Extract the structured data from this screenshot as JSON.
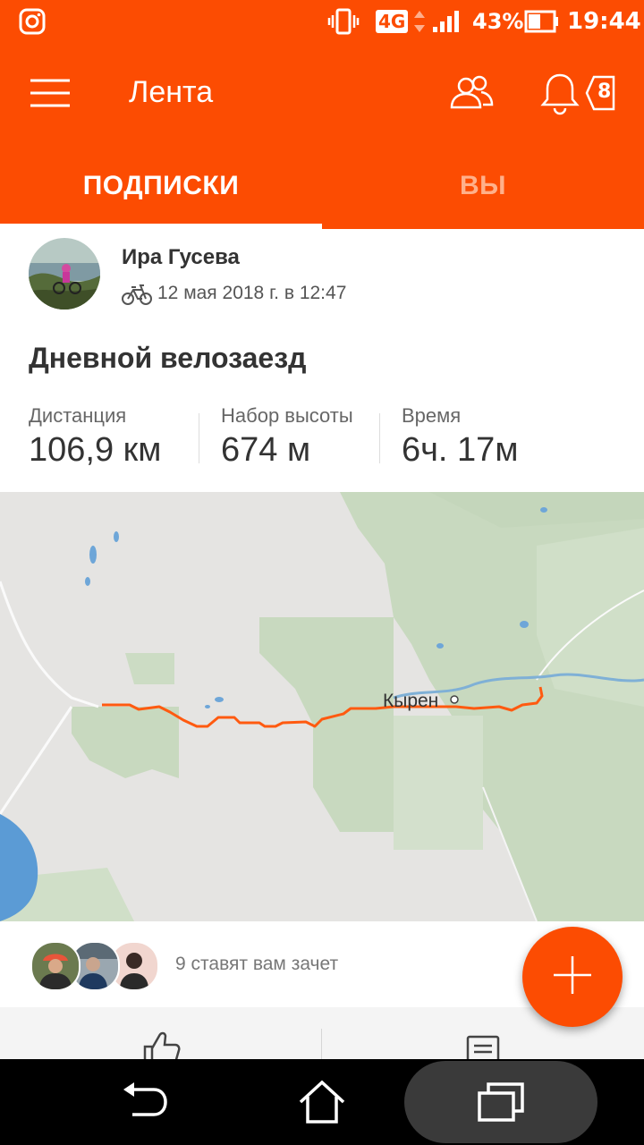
{
  "status_bar": {
    "network": "4G",
    "battery": "43%",
    "time": "19:44",
    "icons": [
      "instagram-icon",
      "vibrate-icon",
      "signal-icon",
      "battery-icon"
    ]
  },
  "header": {
    "title": "Лента",
    "notification_count": "8",
    "icons": [
      "menu-icon",
      "people-icon",
      "bell-icon"
    ]
  },
  "tabs": [
    {
      "label": "ПОДПИСКИ",
      "active": true
    },
    {
      "label": "ВЫ",
      "active": false
    }
  ],
  "activity": {
    "athlete": "Ира Гусева",
    "date": "12 мая 2018 г. в 12:47",
    "sport_icon": "bike-icon",
    "title": "Дневной велозаезд",
    "stats": [
      {
        "label": "Дистанция",
        "value": "106,9 км"
      },
      {
        "label": "Набор высоты",
        "value": "674 м"
      },
      {
        "label": "Время",
        "value": "6ч. 17м"
      }
    ]
  },
  "map": {
    "place_label": "Кырен"
  },
  "kudos": {
    "text": "9 ставят вам зачет"
  },
  "actions": {
    "icons": [
      "thumbs-up-icon",
      "comment-icon"
    ]
  },
  "fab": {
    "icon": "plus-icon"
  },
  "nav": {
    "icons": [
      "back-icon",
      "home-icon",
      "recents-icon"
    ]
  },
  "colors": {
    "brand": "#fc4c02",
    "route": "#ff5a10",
    "text": "#333333",
    "muted": "#666666"
  }
}
